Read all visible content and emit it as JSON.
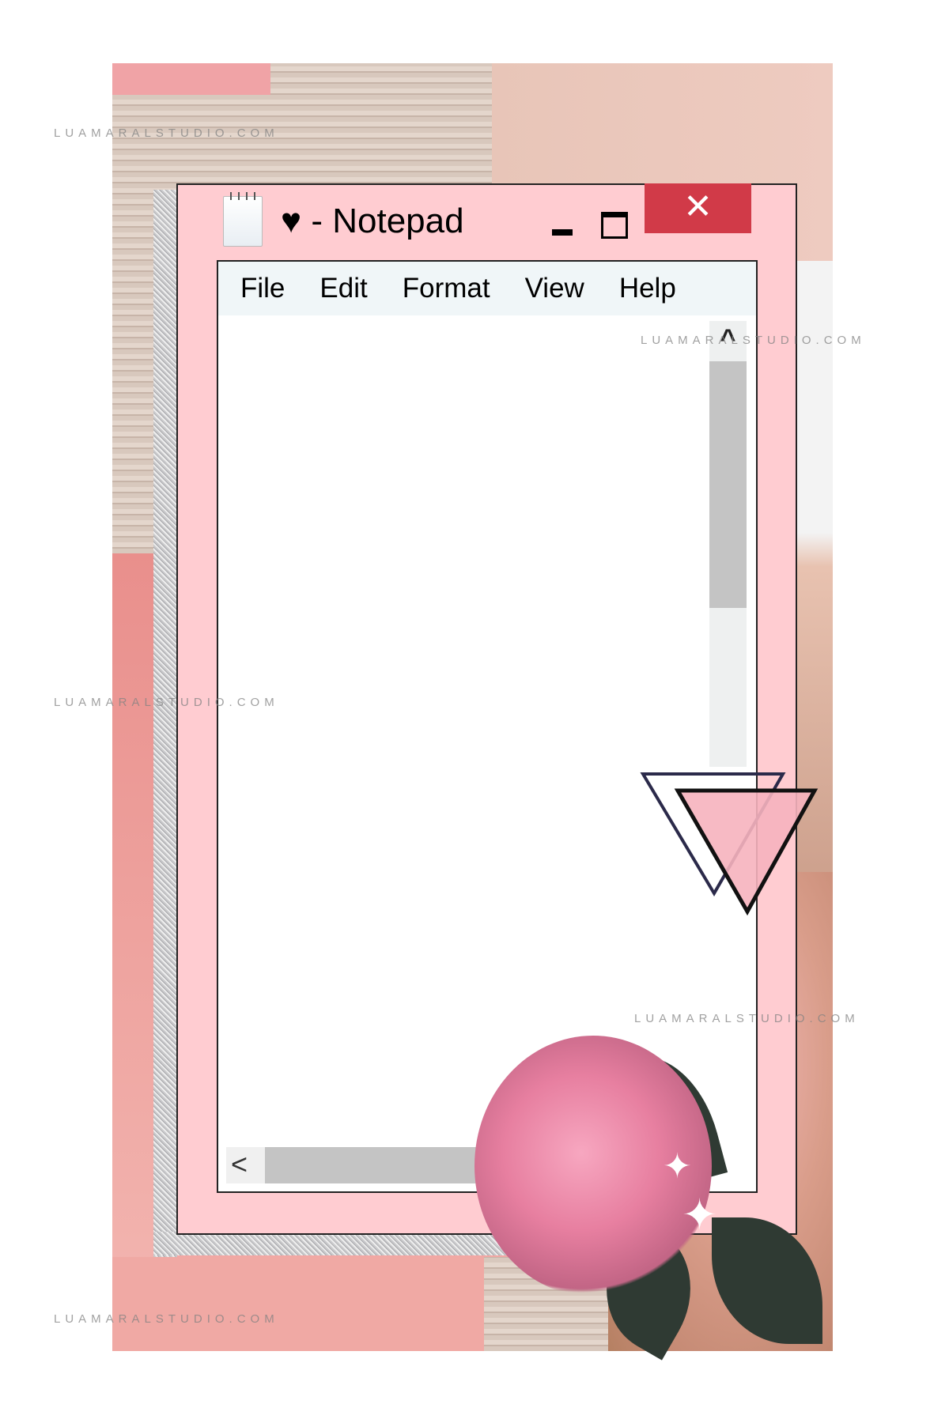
{
  "window": {
    "title": "♥  - Notepad",
    "close_label": "✕",
    "menu": [
      "File",
      "Edit",
      "Format",
      "View",
      "Help"
    ],
    "text_content": "",
    "scroll_up_icon": "^",
    "scroll_left_icon": "<"
  },
  "icons": {
    "app": "notepad-icon",
    "minimize": "minimize-icon",
    "maximize": "maximize-icon",
    "close": "close-icon"
  },
  "watermark": "LUAMARALSTUDIO.COM",
  "colors": {
    "window_bg": "#ffccd1",
    "close_bg": "#d13a48",
    "menu_bg": "#f0f6f8",
    "scroll_thumb": "#c4c4c4"
  }
}
